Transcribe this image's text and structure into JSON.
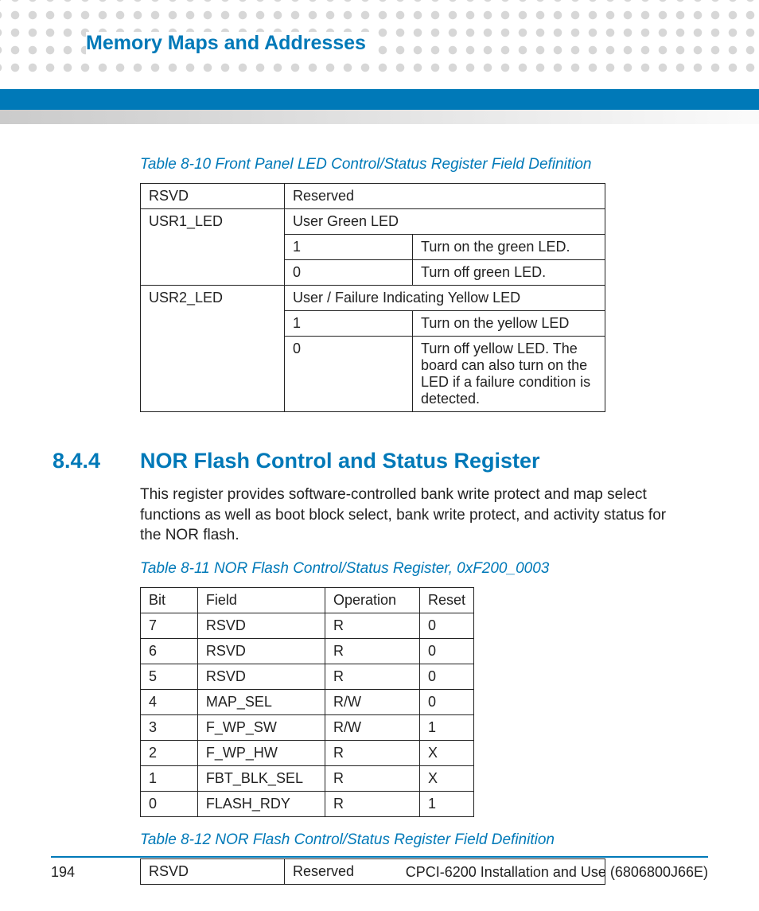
{
  "page_header": "Memory Maps and Addresses",
  "tables": {
    "t10": {
      "caption": "Table 8-10 Front Panel LED Control/Status Register Field Definition",
      "rows": {
        "rsvd_field": "RSVD",
        "rsvd_desc": "Reserved",
        "usr1_field": "USR1_LED",
        "usr1_desc": "User Green LED",
        "usr1_1_val": "1",
        "usr1_1_desc": "Turn on the green LED.",
        "usr1_0_val": "0",
        "usr1_0_desc": "Turn off green LED.",
        "usr2_field": "USR2_LED",
        "usr2_desc": "User / Failure Indicating Yellow LED",
        "usr2_1_val": "1",
        "usr2_1_desc": "Turn on the yellow LED",
        "usr2_0_val": "0",
        "usr2_0_desc": "Turn off yellow LED. The board can also turn on the LED if a failure condition is detected."
      }
    },
    "t11": {
      "caption": "Table 8-11 NOR Flash Control/Status Register, 0xF200_0003",
      "headers": {
        "c0": "Bit",
        "c1": "Field",
        "c2": "Operation",
        "c3": "Reset"
      },
      "data": [
        {
          "c0": "7",
          "c1": "RSVD",
          "c2": "R",
          "c3": "0"
        },
        {
          "c0": "6",
          "c1": "RSVD",
          "c2": "R",
          "c3": "0"
        },
        {
          "c0": "5",
          "c1": "RSVD",
          "c2": "R",
          "c3": "0"
        },
        {
          "c0": "4",
          "c1": "MAP_SEL",
          "c2": "R/W",
          "c3": "0"
        },
        {
          "c0": "3",
          "c1": "F_WP_SW",
          "c2": "R/W",
          "c3": "1"
        },
        {
          "c0": "2",
          "c1": "F_WP_HW",
          "c2": "R",
          "c3": "X"
        },
        {
          "c0": "1",
          "c1": "FBT_BLK_SEL",
          "c2": "R",
          "c3": "X"
        },
        {
          "c0": "0",
          "c1": "FLASH_RDY",
          "c2": "R",
          "c3": "1"
        }
      ]
    },
    "t12": {
      "caption": "Table 8-12 NOR Flash Control/Status Register Field Definition",
      "rsvd_field": "RSVD",
      "rsvd_desc": "Reserved"
    }
  },
  "section": {
    "number": "8.4.4",
    "title": "NOR Flash Control and Status Register",
    "body": "This register provides software-controlled bank write protect and map select functions as well as boot block select, bank write protect, and activity status for the NOR flash."
  },
  "footer": {
    "page": "194",
    "doc": "CPCI-6200 Installation and Use (6806800J66E)"
  }
}
